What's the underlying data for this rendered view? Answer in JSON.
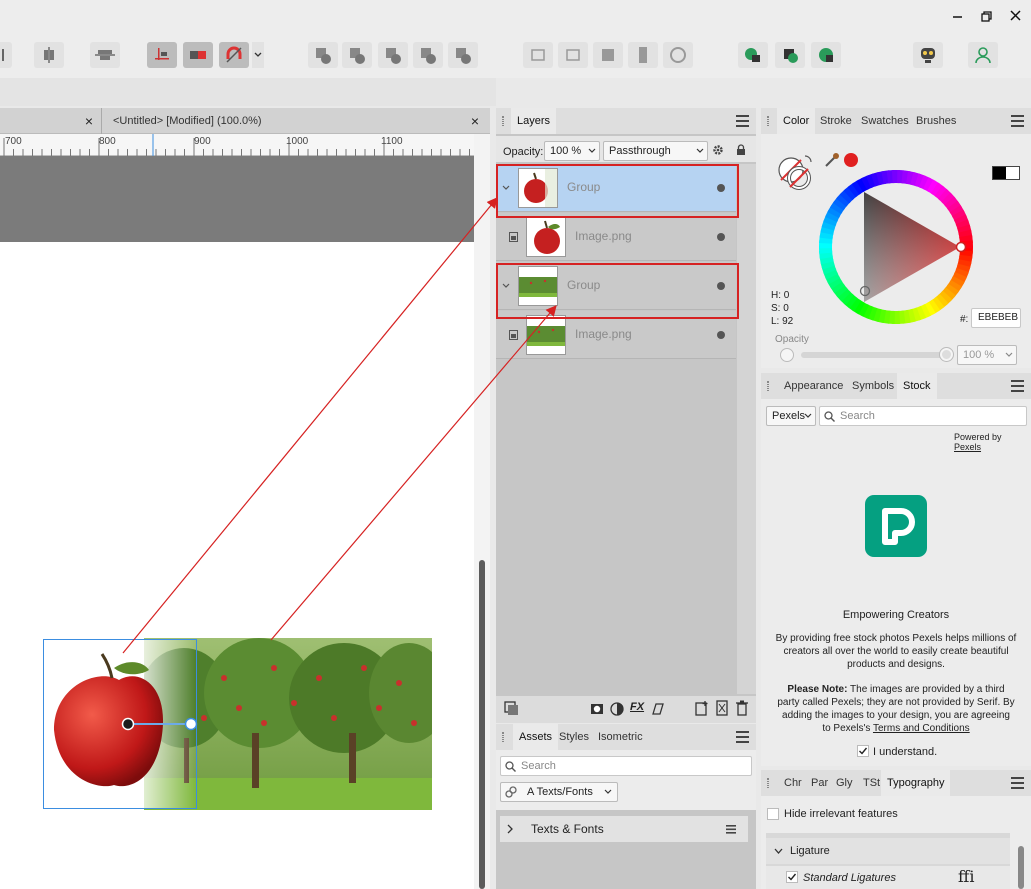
{
  "tabs": {
    "doc1_close": "×",
    "doc2_title": "<Untitled> [Modified] (100.0%)",
    "doc2_close": "×"
  },
  "ruler": {
    "ticks": [
      "700",
      "800",
      "900",
      "1000",
      "1100"
    ]
  },
  "layers": {
    "tab_label": "Layers",
    "opacity_label": "Opacity:",
    "opacity_value": "100 %",
    "blend_mode": "Passthrough",
    "rows": [
      {
        "name": "Group"
      },
      {
        "name": "Image.png"
      },
      {
        "name": "Group"
      },
      {
        "name": "Image.png"
      }
    ]
  },
  "color": {
    "tabs": [
      "Color",
      "Stroke",
      "Swatches",
      "Brushes"
    ],
    "h": "H: 0",
    "s": "S: 0",
    "l": "L: 92",
    "hex_label": "#:",
    "hex_value": "EBEBEB",
    "opacity_label": "Opacity",
    "opacity_value": "100 %"
  },
  "stock": {
    "tabs": [
      "Appearance",
      "Symbols",
      "Stock"
    ],
    "provider": "Pexels",
    "search_placeholder": "Search",
    "powered_by": "Powered by",
    "powered_link": "Pexels",
    "tagline": "Empowering Creators",
    "desc1": "By providing free stock photos Pexels helps millions of",
    "desc2": "creators all over the world to easily create beautiful",
    "desc3": "products and designs.",
    "note_bold": "Please Note:",
    "note1": "The images are provided by a third",
    "note2": "party called Pexels; they are not provided by Serif. By",
    "note3": "adding the images to your design, you are agreeing",
    "note4_pre": "to Pexels's",
    "note4_link": "Terms and Conditions",
    "understand": "I understand."
  },
  "assets": {
    "tabs": [
      "Assets",
      "Styles",
      "Isometric"
    ],
    "search_placeholder": "Search",
    "category": "A Texts/Fonts",
    "section": "Texts & Fonts"
  },
  "typography": {
    "tabs": [
      "Chr",
      "Par",
      "Gly",
      "TSt",
      "Typography"
    ],
    "hide_label": "Hide irrelevant features",
    "section": "Ligature",
    "item": "Standard Ligatures",
    "glyph": "ffi"
  },
  "colors": {
    "selection_blue": "#b6d3f2",
    "annotation_red": "#d62222",
    "pexels_teal": "#05a081"
  }
}
